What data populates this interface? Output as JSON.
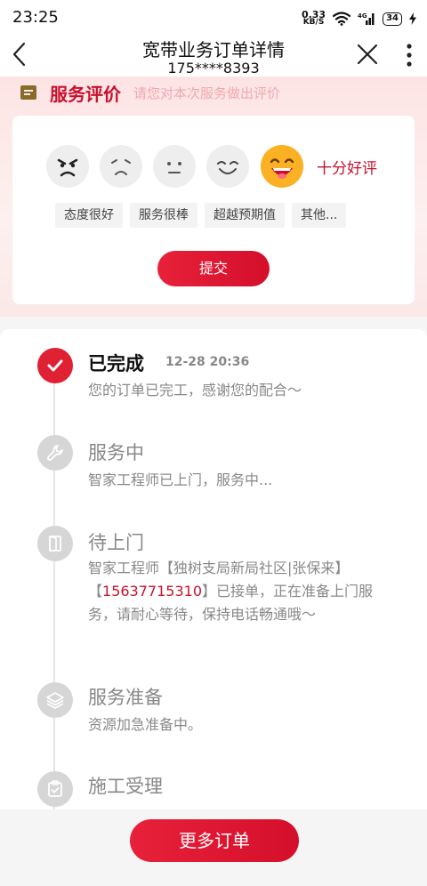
{
  "status": {
    "time": "23:25",
    "speed_value": "0.33",
    "speed_unit": "KB/S",
    "signal": "4G",
    "battery": "34"
  },
  "nav": {
    "title": "宽带业务订单详情",
    "subtitle": "175****8393"
  },
  "rating": {
    "title": "服务评价",
    "hint": "请您对本次服务做出评价",
    "selected_label": "十分好评",
    "faces": [
      "angry-face-icon",
      "sad-face-icon",
      "neutral-face-icon",
      "smile-face-icon",
      "grin-face-icon"
    ],
    "tags": [
      "态度很好",
      "服务很棒",
      "超越预期值",
      "其他..."
    ],
    "submit": "提交"
  },
  "timeline": [
    {
      "title": "已完成",
      "time": "12-28 20:36",
      "desc": "您的订单已完工，感谢您的配合～",
      "icon": "check-icon",
      "status": "done"
    },
    {
      "title": "服务中",
      "desc": "智家工程师已上门，服务中...",
      "icon": "wrench-icon"
    },
    {
      "title": "待上门",
      "desc_pre": "智家工程师【独树支局新局社区|张保来】【",
      "phone": "15637715310",
      "desc_post": "】已接单，正在准备上门服务，请耐心等待，保持电话畅通哦～",
      "icon": "door-icon"
    },
    {
      "title": "服务准备",
      "desc": "资源加急准备中。",
      "icon": "layers-icon"
    },
    {
      "title": "施工受理",
      "icon": "clipboard-check-icon"
    }
  ],
  "bottom": {
    "more_orders": "更多订单"
  },
  "colors": {
    "accent": "#c8102e",
    "button": "#e02033"
  }
}
